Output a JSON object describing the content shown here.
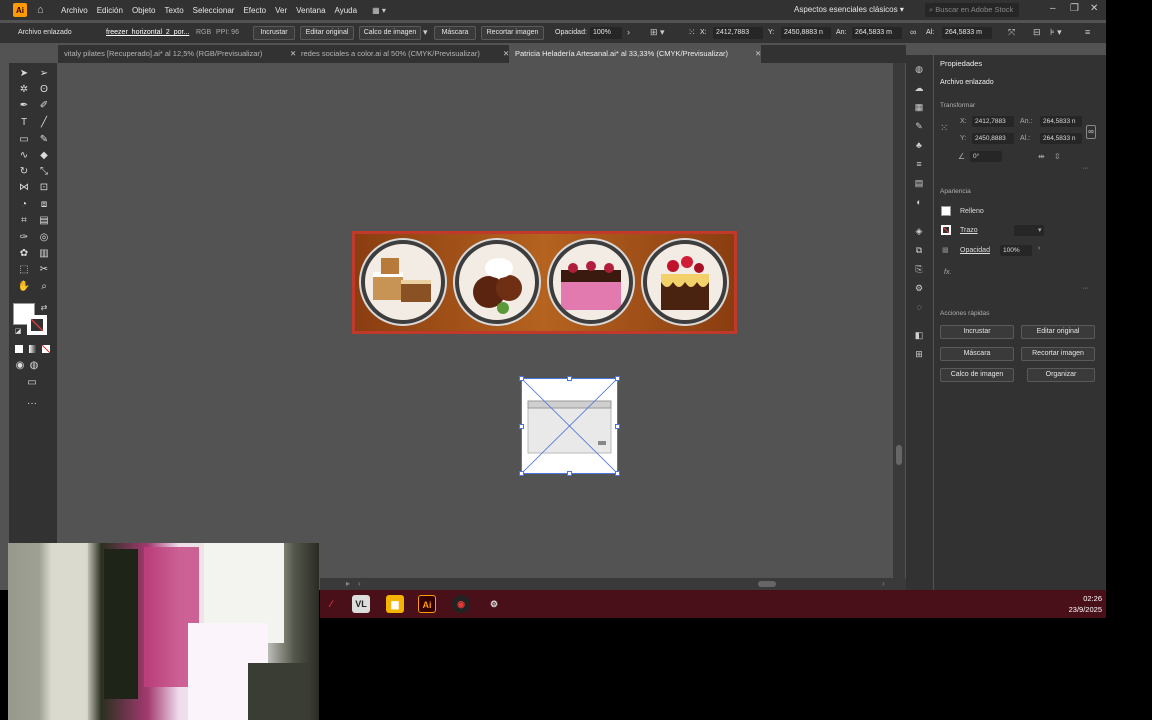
{
  "menubar": {
    "logo": "Ai",
    "menu": [
      "Archivo",
      "Edición",
      "Objeto",
      "Texto",
      "Seleccionar",
      "Efecto",
      "Ver",
      "Ventana",
      "Ayuda"
    ],
    "workspace": "Aspectos esenciales clásicos",
    "search_placeholder": "Buscar en Adobe Stock"
  },
  "control_bar": {
    "object_type": "Archivo enlazado",
    "filename": "freezer_horizontal_2_por...",
    "color_mode": "RGB",
    "ppi": "PPI: 96",
    "embed": "Incrustar",
    "edit_original": "Editar original",
    "image_trace": "Calco de imagen",
    "mask": "Máscara",
    "crop": "Recortar imagen",
    "opacity_label": "Opacidad:",
    "opacity_value": "100%",
    "x_label": "X:",
    "x_value": "2412,7883",
    "y_label": "Y:",
    "y_value": "2450,8883 n",
    "w_label": "An:",
    "w_value": "264,5833 m",
    "h_label": "Al:",
    "h_value": "264,5833 m"
  },
  "tabs": [
    {
      "label": "vitaly pilates [Recuperado].ai* al 12,5% (RGB/Previsualizar)",
      "active": false
    },
    {
      "label": "redes sociales a color.ai al 50% (CMYK/Previsualizar)",
      "active": false
    },
    {
      "label": "Patricia Heladería Artesanal.ai* al 33,33% (CMYK/Previsualizar)",
      "active": true
    }
  ],
  "properties": {
    "title": "Propiedades",
    "object_type": "Archivo enlazado",
    "transform_label": "Transformar",
    "x_label": "X:",
    "x_value": "2412,7883",
    "y_label": "Y:",
    "y_value": "2450,8883",
    "w_label": "An.:",
    "w_value": "264,5833 n",
    "h_label": "Al.:",
    "h_value": "264,5833 n",
    "angle_value": "0°",
    "appearance_label": "Apariencia",
    "fill_label": "Relleno",
    "stroke_label": "Trazo",
    "opacity_label": "Opacidad",
    "opacity_value": "100%",
    "fx_label": "fx.",
    "quick_actions_label": "Acciones rápidas",
    "buttons": [
      "Incrustar",
      "Editar original",
      "Máscara",
      "Recortar imagen",
      "Calco de imagen",
      "Organizar"
    ]
  },
  "taskbar": {
    "time": "02:26",
    "date": "23/9/2025"
  },
  "colors": {
    "accent": "#4a76d9",
    "banner_frame": "#c0392b",
    "taskbar": "#4a1019"
  }
}
